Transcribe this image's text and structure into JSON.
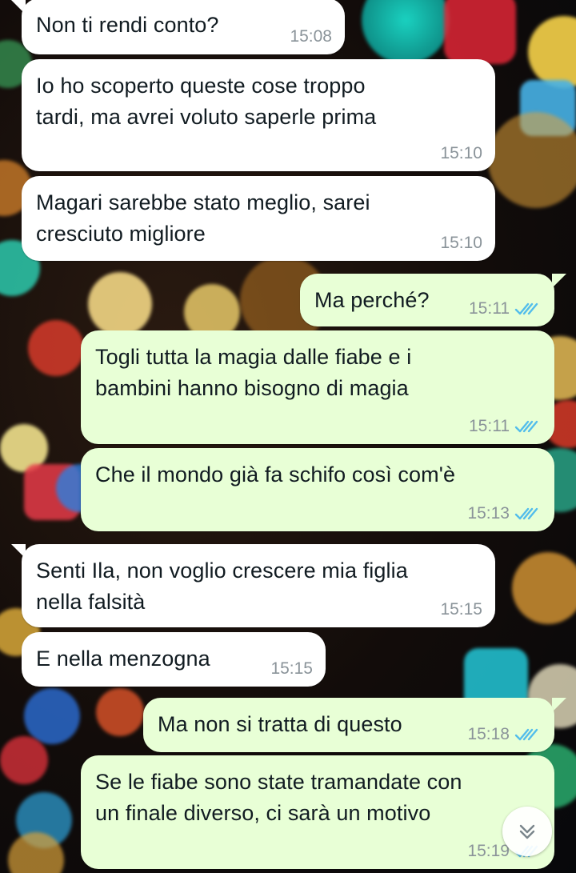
{
  "messages": [
    {
      "direction": "in",
      "text": "Non ti rendi conto?",
      "time": "15:08"
    },
    {
      "direction": "in",
      "text": "Io ho scoperto queste cose troppo\ntardi, ma avrei voluto saperle prima",
      "time": "15:10"
    },
    {
      "direction": "in",
      "text": "Magari sarebbe stato meglio, sarei\ncresciuto migliore",
      "time": "15:10"
    },
    {
      "direction": "out",
      "text": "Ma perché?",
      "time": "15:11",
      "status": "read"
    },
    {
      "direction": "out",
      "text": "Togli tutta la magia dalle fiabe e i\nbambini hanno bisogno di magia",
      "time": "15:11",
      "status": "read"
    },
    {
      "direction": "out",
      "text": "Che il mondo già fa schifo così com'è",
      "time": "15:13",
      "status": "read"
    },
    {
      "direction": "in",
      "text": "Senti Ila, non voglio crescere mia figlia\nnella falsità",
      "time": "15:15"
    },
    {
      "direction": "in",
      "text": "E nella menzogna",
      "time": "15:15"
    },
    {
      "direction": "out",
      "text": "Ma non si tratta di questo",
      "time": "15:18",
      "status": "read"
    },
    {
      "direction": "out",
      "text": "Se le fiabe sono state tramandate con\nun finale diverso, ci sarà un motivo",
      "time": "15:19",
      "status": "read"
    }
  ],
  "icons": {
    "read_ticks": "double-check-icon",
    "scroll_down": "chevron-double-down-icon"
  },
  "colors": {
    "incoming_bubble": "#ffffff",
    "outgoing_bubble": "#e8ffd6",
    "read_tick": "#53bdeb",
    "timestamp": "#8a9399"
  }
}
